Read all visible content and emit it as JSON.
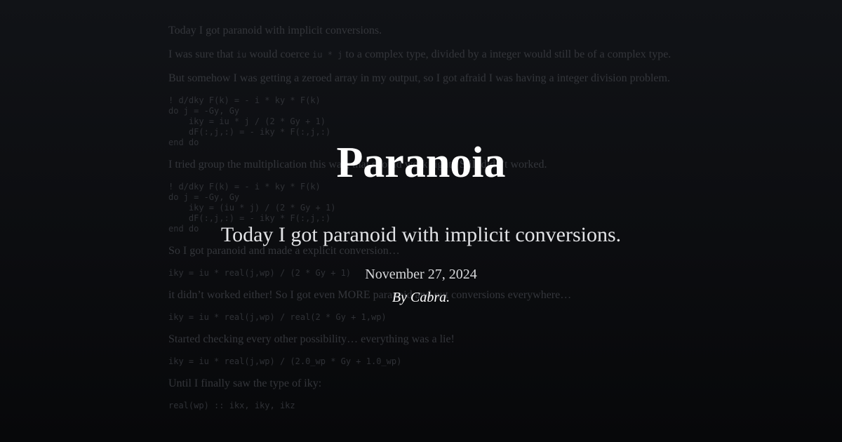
{
  "article_background": {
    "p1": "Today I got paranoid with implicit conversions.",
    "p2_before": "I was sure that ",
    "p2_code1": "iu",
    "p2_mid": " would coerce ",
    "p2_code2": "iu * j",
    "p2_after": " to a complex type, divided by a integer would still be of a complex type.",
    "p3": "But somehow I was getting a zeroed array in my output, so I got afraid I was having a integer division problem.",
    "code1": "! d/dky F(k) = - i * ky * F(k)\ndo j = -Gy, Gy\n    iky = iu * j / (2 * Gy + 1)\n    dF(:,j,:) = - iky * F(:,j,:)\nend do",
    "p4": "I tried group the multiplication this way, that should work right? Still didn’t worked.",
    "code2": "! d/dky F(k) = - i * ky * F(k)\ndo j = -Gy, Gy\n    iky = (iu * j) / (2 * Gy + 1)\n    dF(:,j,:) = - iky * F(:,j,:)\nend do",
    "p5": "So I got paranoid and made a explicit conversion…",
    "code3": "iky = iu * real(j,wp) / (2 * Gy + 1)",
    "p6": "it didn’t worked either! So I got even MORE paranoid and put conversions everywhere…",
    "code4": "iky = iu * real(j,wp) / real(2 * Gy + 1,wp)",
    "p7": "Started checking every other possibility… everything was a lie!",
    "code5": "iky = iu * real(j,wp) / (2.0_wp * Gy + 1.0_wp)",
    "p8": "Until I finally saw the type of iky:",
    "code6": "real(wp) :: ikx, iky, ikz"
  },
  "card": {
    "title": "Paranoia",
    "subtitle": "Today I got paranoid with implicit conversions.",
    "date": "November 27, 2024",
    "byline": "By Cabra."
  },
  "colors": {
    "background_top": "#111317",
    "background_bottom": "#07080a",
    "faded_text": "#34363b",
    "title": "#ffffff",
    "subtitle": "#e2e3e6"
  }
}
